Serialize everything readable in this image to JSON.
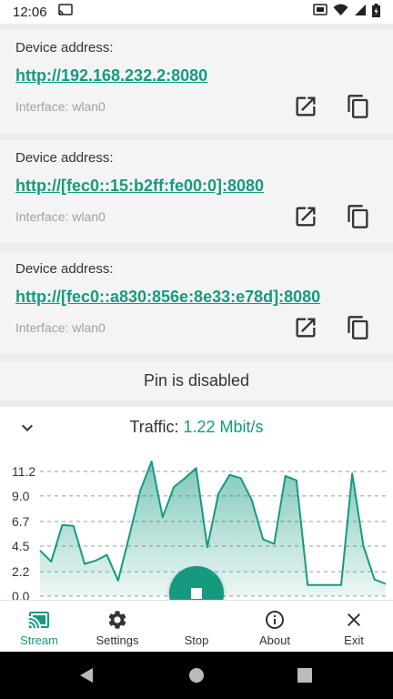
{
  "status_bar": {
    "time": "12:06"
  },
  "devices": [
    {
      "label": "Device address:",
      "url": "http://192.168.232.2:8080",
      "interface": "Interface: wlan0"
    },
    {
      "label": "Device address:",
      "url": "http://[fec0::15:b2ff:fe00:0]:8080",
      "interface": "Interface: wlan0"
    },
    {
      "label": "Device address:",
      "url": "http://[fec0::a830:856e:8e33:e78d]:8080",
      "interface": "Interface: wlan0"
    }
  ],
  "pin_status": "Pin is disabled",
  "traffic": {
    "label": "Traffic: ",
    "value": "1.22 Mbit/s"
  },
  "chart_data": {
    "type": "area",
    "y_ticks": [
      "11.2",
      "9.0",
      "6.7",
      "4.5",
      "2.2",
      "0.0"
    ],
    "ylim": [
      0,
      12.5
    ],
    "grid": true,
    "color": "#159a80",
    "values": [
      4.1,
      3.1,
      6.4,
      6.3,
      2.9,
      3.2,
      3.7,
      1.4,
      5.4,
      9.5,
      12.1,
      7.1,
      9.8,
      10.6,
      11.5,
      4.4,
      9.2,
      10.9,
      10.6,
      8.6,
      5.1,
      4.7,
      10.8,
      10.4,
      1.0,
      1.0,
      1.0,
      1.0,
      11.0,
      4.5,
      1.5,
      1.1
    ]
  },
  "fab": {
    "label": "Stop"
  },
  "nav": {
    "stream": "Stream",
    "settings": "Settings",
    "stop": "Stop",
    "about": "About",
    "exit": "Exit"
  },
  "colors": {
    "accent": "#159a80",
    "card_bg": "#f4f4f4"
  }
}
